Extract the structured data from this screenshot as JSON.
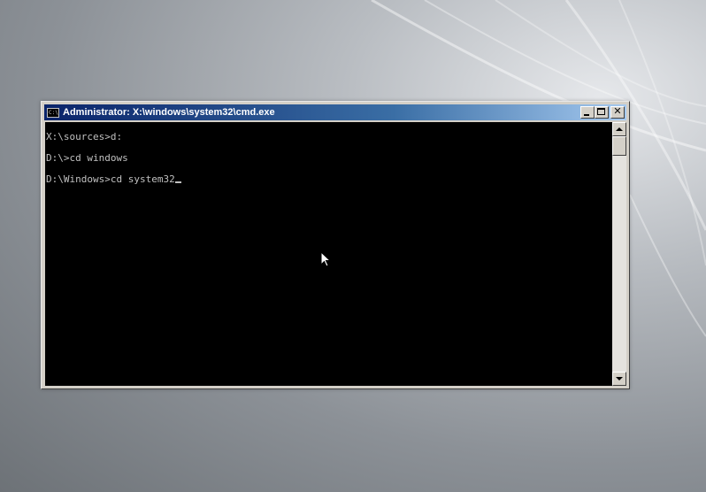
{
  "window": {
    "title": "Administrator: X:\\windows\\system32\\cmd.exe",
    "icon": "cmd-icon",
    "icon_text": "C:\\",
    "buttons": {
      "minimize": "minimize-icon",
      "maximize": "maximize-icon",
      "close_glyph": "✕"
    }
  },
  "console": {
    "lines": [
      "X:\\sources>d:",
      "D:\\>cd windows",
      "D:\\Windows>cd system32"
    ],
    "cursor": "_"
  },
  "colors": {
    "console_background": "#000000",
    "console_text": "#c0c0c0",
    "title_bar_start": "#0a246a",
    "title_bar_end": "#a6caf0",
    "window_frame": "#d4d0c8"
  },
  "icons": {
    "mouse_pointer": "arrow-cursor-icon",
    "scroll_up": "arrow-up-icon",
    "scroll_down": "arrow-down-icon"
  }
}
